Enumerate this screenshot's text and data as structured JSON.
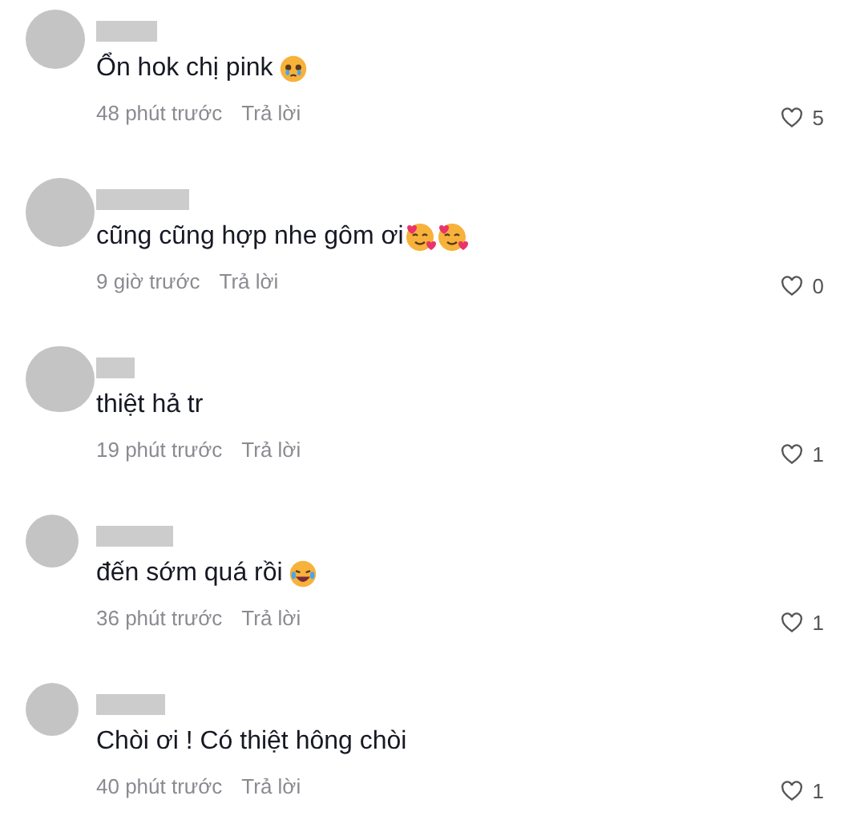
{
  "comments": [
    {
      "text": "Ổn hok chị pink",
      "emojis": [
        {
          "kind": "teary"
        }
      ],
      "time": "48 phút trước",
      "reply": "Trả lời",
      "likes": "5"
    },
    {
      "text": "cũng cũng hợp nhe gôm ơi",
      "emojis": [
        {
          "kind": "hearts"
        },
        {
          "kind": "hearts"
        }
      ],
      "time": "9 giờ trước",
      "reply": "Trả lời",
      "likes": "0"
    },
    {
      "text": "thiệt hả tr",
      "time": "19 phút trước",
      "reply": "Trả lời",
      "likes": "1"
    },
    {
      "text": "đến sớm quá rồi",
      "emojis": [
        {
          "kind": "laugh"
        }
      ],
      "time": "36 phút trước",
      "reply": "Trả lời",
      "likes": "1"
    },
    {
      "text": "Chòi ơi ! Có thiệt hông chòi",
      "time": "40 phút trước",
      "reply": "Trả lời",
      "likes": "1"
    }
  ]
}
